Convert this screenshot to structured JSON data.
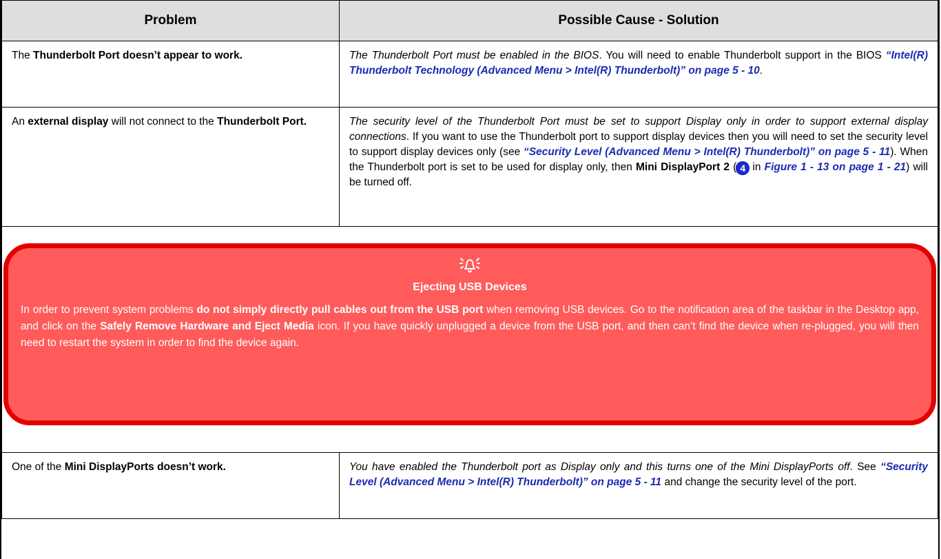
{
  "headers": {
    "problem": "Problem",
    "solution": "Possible Cause - Solution"
  },
  "row1": {
    "p_pre": "The ",
    "p_bold": "Thunderbolt Port doesn’t appear to work.",
    "s_italic": "The Thunderbolt Port must be enabled in the BIOS",
    "s_text": ". You will need to enable Thunderbolt support in the BIOS ",
    "s_link": "“Intel(R) Thunderbolt Technology (Advanced Menu > Intel(R) Thunderbolt)” on page 5 - 10",
    "s_end": "."
  },
  "row2": {
    "p_pre": "An ",
    "p_bold1": "external display",
    "p_mid": " will not connect to the ",
    "p_bold2": "Thunderbolt Port.",
    "s_italic": "The security level of the Thunderbolt Port must be set to support Display only in order to support external display connections",
    "s_text1": ". If you want to use the Thunderbolt port to support display devices then you will need to set the security level to support display devices only (see ",
    "s_link1": "“Security Level (Advanced Menu > Intel(R) Thunderbolt)” on page 5 - 11",
    "s_text2": "). When the Thunderbolt port is set to be used for display only, then ",
    "s_bold": "Mini DisplayPort 2",
    "s_text3": " (",
    "s_badge": "4",
    "s_text4": " in ",
    "s_link2": "Figure 1 - 13 on page 1 - 21",
    "s_text5": ") will be turned off."
  },
  "warning": {
    "icon": "alarm-bell-icon",
    "title": "Ejecting USB Devices",
    "t1": "In order to prevent system problems ",
    "b1": "do not simply directly pull cables out from the USB port",
    "t2": " when removing USB devices. Go to the notification area of the taskbar in the Desktop app, and click on the ",
    "b2": "Safely Remove Hardware and Eject Media",
    "t3": " icon. If you have quickly unplugged a device from the USB port, and then can’t find the device when re-plugged, you will then need to restart the system in order to find the device again.",
    "colors": {
      "fill": "#ff5b5b",
      "border": "#e20000"
    }
  },
  "row3": {
    "p_pre": "One of the ",
    "p_bold": "Mini DisplayPorts doesn’t work.",
    "s_italic": "You have enabled the Thunderbolt port as Display only and this turns one of the Mini DisplayPorts off",
    "s_text1": ". See ",
    "s_link": "“Security Level (Advanced Menu > Intel(R) Thunderbolt)” on page 5 - 11",
    "s_text2": " and change the security level of the port."
  },
  "colors": {
    "header_bg": "#dedede",
    "link": "#1a2ab3",
    "badge": "#1b2bd6"
  }
}
